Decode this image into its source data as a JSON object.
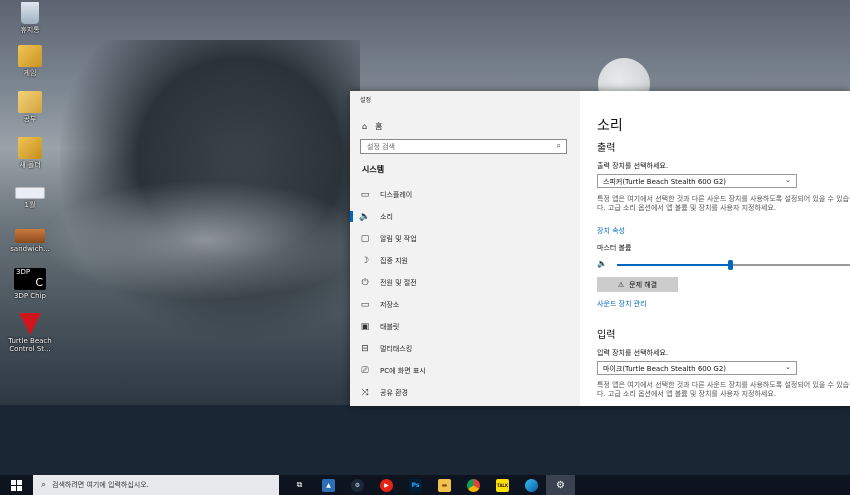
{
  "desktop": {
    "icons": [
      {
        "label": "휴지통",
        "icon": "recycle-bin-icon"
      },
      {
        "label": "게임",
        "icon": "folder-icon"
      },
      {
        "label": "공부",
        "icon": "folder-icon"
      },
      {
        "label": "새 폴더",
        "icon": "folder-icon"
      },
      {
        "label": "1월",
        "icon": "image-file-icon"
      },
      {
        "label": "sandwich...",
        "icon": "image-file-icon"
      },
      {
        "label": "3DP Chip",
        "icon": "3dp-chip-icon",
        "badge": "3DP",
        "letter": "C"
      },
      {
        "label": "Turtle Beach Control St...",
        "icon": "turtle-beach-icon"
      }
    ]
  },
  "window": {
    "title": "설정",
    "nav": {
      "home": "홈",
      "search_placeholder": "설정 검색",
      "section": "시스템",
      "items": [
        {
          "label": "디스플레이",
          "icon": "monitor-icon"
        },
        {
          "label": "소리",
          "icon": "speaker-icon",
          "active": true
        },
        {
          "label": "알림 및 작업",
          "icon": "notification-icon"
        },
        {
          "label": "집중 지원",
          "icon": "moon-icon"
        },
        {
          "label": "전원 및 절전",
          "icon": "power-icon"
        },
        {
          "label": "저장소",
          "icon": "storage-icon"
        },
        {
          "label": "태블릿",
          "icon": "tablet-icon"
        },
        {
          "label": "멀티태스킹",
          "icon": "multitasking-icon"
        },
        {
          "label": "PC에 화면 표시",
          "icon": "projecting-icon"
        },
        {
          "label": "공유 환경",
          "icon": "shared-icon"
        }
      ]
    },
    "content": {
      "title": "소리",
      "output": {
        "heading": "출력",
        "select_label": "출력 장치를 선택하세요.",
        "device": "스피커(Turtle Beach Stealth 600 G2)",
        "description": "특정 앱은 여기에서 선택한 것과 다른 사운드 장치를 사용하도록 설정되어 있을 수 있습니다. 고급 소리 옵션에서 앱 볼륨 및 장치를 사용자 지정하세요.",
        "device_properties_link": "장치 속성",
        "master_volume_label": "마스터 볼륨",
        "volume_fraction": 0.47,
        "troubleshoot_button": "문제 해결",
        "manage_devices_link": "사운드 장치 관리"
      },
      "input": {
        "heading": "입력",
        "select_label": "입력 장치를 선택하세요.",
        "device": "마이크(Turtle Beach Stealth 600 G2)",
        "description": "특정 앱은 여기에서 선택한 것과 다른 사운드 장치를 사용하도록 설정되어 있을 수 있습니다. 고급 소리 옵션에서 앱 볼륨 및 장치를 사용자 지정하세요."
      }
    }
  },
  "taskbar": {
    "search_placeholder": "검색하려면 여기에 입력하십시오.",
    "apps": [
      {
        "icon": "task-view-icon"
      },
      {
        "icon": "app-icon"
      },
      {
        "icon": "steam-icon"
      },
      {
        "icon": "youtube-icon"
      },
      {
        "icon": "photoshop-icon",
        "text": "Ps"
      },
      {
        "icon": "file-explorer-icon"
      },
      {
        "icon": "chrome-icon"
      },
      {
        "icon": "kakaotalk-icon",
        "text": "TALK"
      },
      {
        "icon": "edge-icon"
      },
      {
        "icon": "settings-gear-icon",
        "active": true
      }
    ]
  }
}
